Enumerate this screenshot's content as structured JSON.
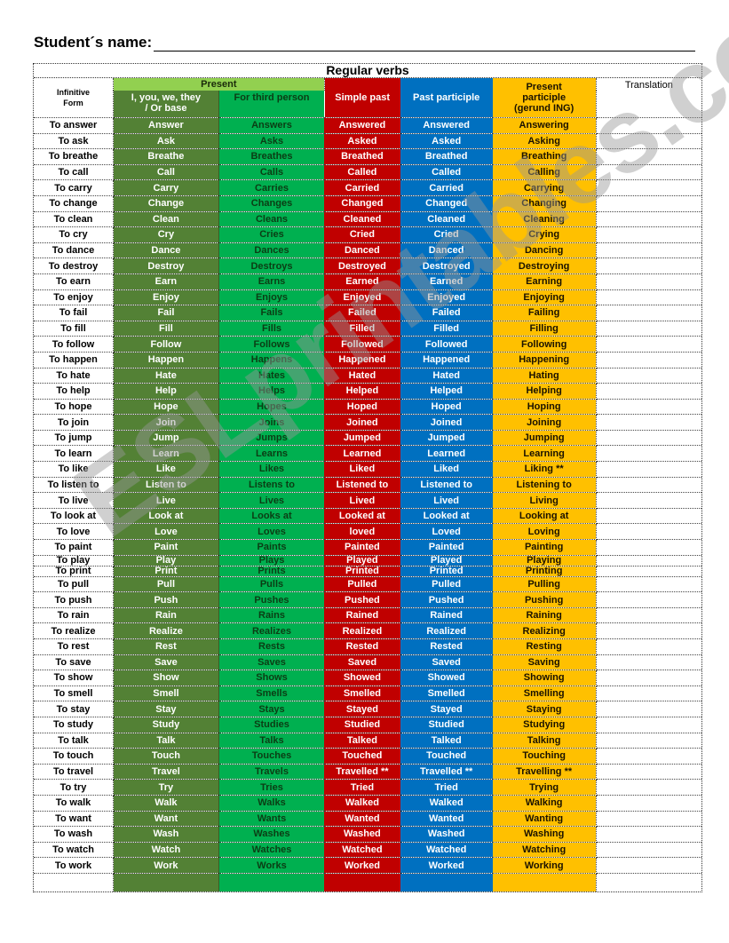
{
  "header": {
    "student_name_label": "Student´s name:"
  },
  "table": {
    "title": "Regular verbs",
    "columns": {
      "infinitive": "Infinitive Form",
      "present_group": "Present",
      "present_base": "I, you, we, they / Or base",
      "present_third": "For third person",
      "simple_past": "Simple past",
      "past_participle": "Past participle",
      "present_participle": "Present participle (gerund    ING)",
      "translation": "Translation"
    },
    "colors": {
      "present_group": "#92d050",
      "present_base": "#538135",
      "present_third": "#00b050",
      "simple_past": "#c00000",
      "past_participle": "#0070c0",
      "present_participle": "#ffc000"
    },
    "rows": [
      [
        "To answer",
        "Answer",
        "Answers",
        "Answered",
        "Answered",
        "Answering"
      ],
      [
        "To ask",
        "Ask",
        "Asks",
        "Asked",
        "Asked",
        "Asking"
      ],
      [
        "To breathe",
        "Breathe",
        "Breathes",
        "Breathed",
        "Breathed",
        "Breathing"
      ],
      [
        "To call",
        "Call",
        "Calls",
        "Called",
        "Called",
        "Calling"
      ],
      [
        "To carry",
        "Carry",
        "Carries",
        "Carried",
        "Carried",
        "Carrying"
      ],
      [
        "To change",
        "Change",
        "Changes",
        "Changed",
        "Changed",
        "Changing"
      ],
      [
        "To clean",
        "Clean",
        "Cleans",
        "Cleaned",
        "Cleaned",
        "Cleaning"
      ],
      [
        "To cry",
        "Cry",
        "Cries",
        "Cried",
        "Cried",
        "Crying"
      ],
      [
        "To dance",
        "Dance",
        "Dances",
        "Danced",
        "Danced",
        "Dancing"
      ],
      [
        "To destroy",
        "Destroy",
        "Destroys",
        "Destroyed",
        "Destroyed",
        "Destroying"
      ],
      [
        "To earn",
        "Earn",
        "Earns",
        "Earned",
        "Earned",
        "Earning"
      ],
      [
        "To enjoy",
        "Enjoy",
        "Enjoys",
        "Enjoyed",
        "Enjoyed",
        "Enjoying"
      ],
      [
        "To fail",
        "Fail",
        "Fails",
        "Failed",
        "Failed",
        "Failing"
      ],
      [
        "To fill",
        "Fill",
        "Fills",
        "Filled",
        "Filled",
        "Filling"
      ],
      [
        "To follow",
        "Follow",
        "Follows",
        "Followed",
        "Followed",
        "Following"
      ],
      [
        "To happen",
        "Happen",
        "Happens",
        "Happened",
        "Happened",
        "Happening"
      ],
      [
        "To hate",
        "Hate",
        "Hates",
        "Hated",
        "Hated",
        "Hating"
      ],
      [
        "To help",
        "Help",
        "Helps",
        "Helped",
        "Helped",
        "Helping"
      ],
      [
        "To hope",
        "Hope",
        "Hopes",
        "Hoped",
        "Hoped",
        "Hoping"
      ],
      [
        "To join",
        "Join",
        "Joins",
        "Joined",
        "Joined",
        "Joining"
      ],
      [
        "To jump",
        "Jump",
        "Jumps",
        "Jumped",
        "Jumped",
        "Jumping"
      ],
      [
        "To learn",
        "Learn",
        "Learns",
        "Learned",
        "Learned",
        "Learning"
      ],
      [
        "To like",
        "Like",
        "Likes",
        "Liked",
        "Liked",
        "Liking **"
      ],
      [
        "To listen to",
        "Listen to",
        "Listens to",
        "Listened to",
        "Listened to",
        "Listening to"
      ],
      [
        "To live",
        "Live",
        "Lives",
        "Lived",
        "Lived",
        "Living"
      ],
      [
        "To look at",
        "Look at",
        "Looks at",
        "Looked at",
        "Looked at",
        "Looking at"
      ],
      [
        "To love",
        "Love",
        "Loves",
        "loved",
        "Loved",
        "Loving"
      ],
      [
        "To paint",
        "Paint",
        "Paints",
        "Painted",
        "Painted",
        "Painting"
      ],
      [
        "To play",
        "Play",
        "Plays",
        "Played",
        "Played",
        "Playing"
      ],
      [
        "To print",
        "Print",
        "Prints",
        "Printed",
        "Printed",
        "Printing"
      ],
      [
        "To pull",
        "Pull",
        "Pulls",
        "Pulled",
        "Pulled",
        "Pulling"
      ],
      [
        "To push",
        "Push",
        "Pushes",
        "Pushed",
        "Pushed",
        "Pushing"
      ],
      [
        "To rain",
        "Rain",
        "Rains",
        "Rained",
        "Rained",
        "Raining"
      ],
      [
        "To realize",
        "Realize",
        "Realizes",
        "Realized",
        "Realized",
        "Realizing"
      ],
      [
        "To rest",
        "Rest",
        "Rests",
        "Rested",
        "Rested",
        "Resting"
      ],
      [
        "To save",
        "Save",
        "Saves",
        "Saved",
        "Saved",
        "Saving"
      ],
      [
        "To show",
        "Show",
        "Shows",
        "Showed",
        "Showed",
        "Showing"
      ],
      [
        "To smell",
        "Smell",
        "Smells",
        "Smelled",
        "Smelled",
        "Smelling"
      ],
      [
        "To stay",
        "Stay",
        "Stays",
        "Stayed",
        "Stayed",
        "Staying"
      ],
      [
        "To study",
        "Study",
        "Studies",
        "Studied",
        "Studied",
        "Studying"
      ],
      [
        "To talk",
        "Talk",
        "Talks",
        "Talked",
        "Talked",
        "Talking"
      ],
      [
        "To touch",
        "Touch",
        "Touches",
        "Touched",
        "Touched",
        "Touching"
      ],
      [
        "To travel",
        "Travel",
        "Travels",
        "Travelled **",
        "Travelled **",
        "Travelling **"
      ],
      [
        "To try",
        "Try",
        "Tries",
        "Tried",
        "Tried",
        "Trying"
      ],
      [
        "To walk",
        "Walk",
        "Walks",
        "Walked",
        "Walked",
        "Walking"
      ],
      [
        "To want",
        "Want",
        "Wants",
        "Wanted",
        "Wanted",
        "Wanting"
      ],
      [
        "To wash",
        "Wash",
        "Washes",
        "Washed",
        "Washed",
        "Washing"
      ],
      [
        "To watch",
        "Watch",
        "Watches",
        "Watched",
        "Watched",
        "Watching"
      ],
      [
        "To work",
        "Work",
        "Works",
        "Worked",
        "Worked",
        "Working"
      ]
    ]
  },
  "watermark": "ESLprintables.com"
}
